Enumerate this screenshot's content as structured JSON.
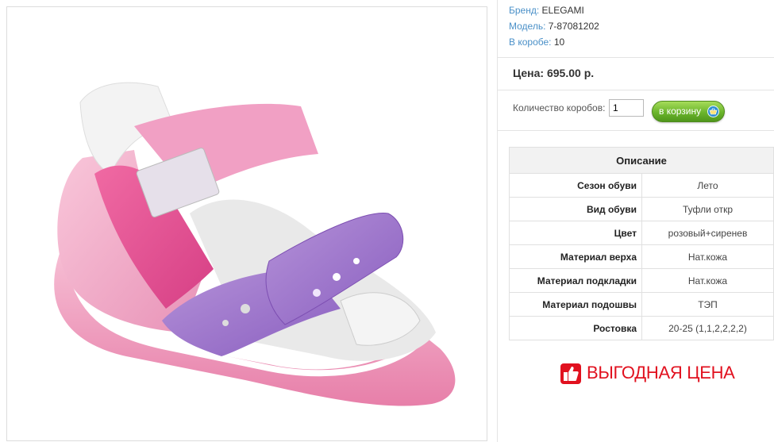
{
  "product": {
    "image_alt": "pink and purple children's sandal",
    "brand_label": "Бренд:",
    "brand_value": "ELEGAMI",
    "model_label": "Модель:",
    "model_value": "7-87081202",
    "box_label": "В коробе:",
    "box_value": "10"
  },
  "price": {
    "text": "Цена: 695.00 р."
  },
  "order": {
    "qty_label": "Количество коробов:",
    "qty_value": "1",
    "cart_button": "в корзину",
    "cart_icon": "basket-icon"
  },
  "description": {
    "title": "Описание",
    "rows": [
      {
        "key": "Сезон обуви",
        "value": "Лето"
      },
      {
        "key": "Вид обуви",
        "value": "Туфли откр"
      },
      {
        "key": "Цвет",
        "value": "розовый+сиренев"
      },
      {
        "key": "Материал верха",
        "value": "Нат.кожа"
      },
      {
        "key": "Материал подкладки",
        "value": "Нат.кожа"
      },
      {
        "key": "Материал подошвы",
        "value": "ТЭП"
      },
      {
        "key": "Ростовка",
        "value": "20-25 (1,1,2,2,2,2)"
      }
    ]
  },
  "promo": {
    "text": "ВЫГОДНАЯ ЦЕНА",
    "icon": "thumbs-up-icon"
  },
  "colors": {
    "link": "#4a90c8",
    "promo": "#e1111f",
    "button": "#6bb52c"
  }
}
